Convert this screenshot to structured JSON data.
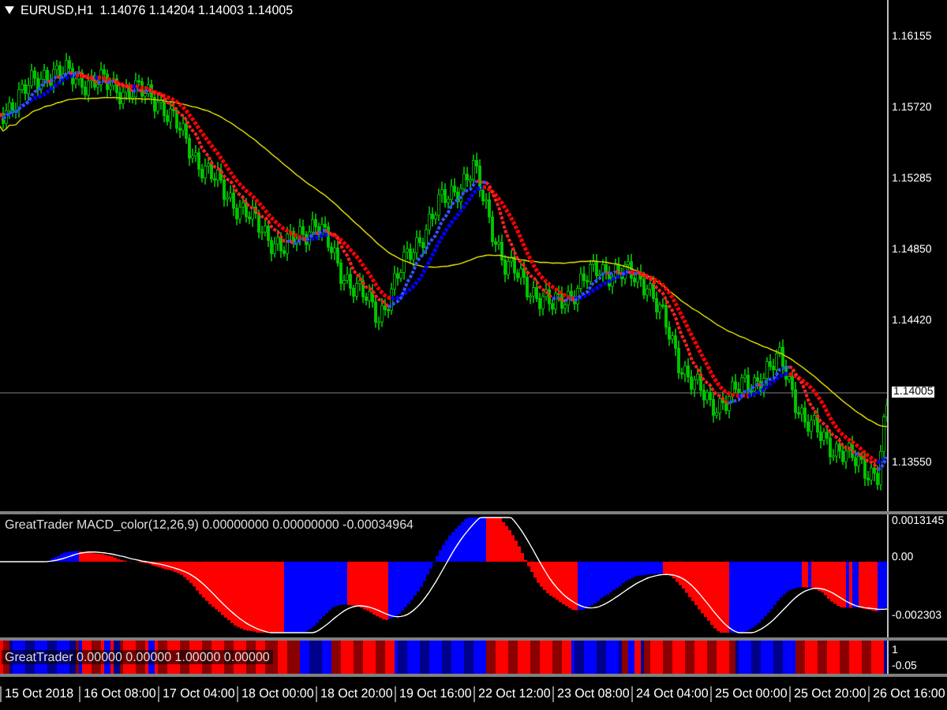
{
  "main_chart": {
    "symbol": "EURUSD,H1",
    "quotes": "1.14076 1.14204 1.14003 1.14005",
    "price_axis": [
      {
        "label": "1.16155",
        "kind": "tick"
      },
      {
        "label": "1.15720",
        "kind": "tick"
      },
      {
        "label": "1.15285",
        "kind": "tick"
      },
      {
        "label": "1.14850",
        "kind": "tick"
      },
      {
        "label": "1.14420",
        "kind": "tick"
      },
      {
        "label": "1.14005",
        "kind": "current"
      },
      {
        "label": "1.13550",
        "kind": "tick"
      }
    ]
  },
  "macd_panel": {
    "header": "GreatTrader MACD_color(12,26,9) 0.00000000 0.00000000 -0.00034964",
    "axis": [
      "0.0013145",
      "0.00",
      "-0.002303"
    ]
  },
  "signal_panel": {
    "header": "GreatTrader 0.00000 0.00000 1.00000 0.00000",
    "axis": [
      "1",
      "-0.05"
    ]
  },
  "time_axis": [
    "15 Oct 2018",
    "16 Oct 08:00",
    "17 Oct 04:00",
    "18 Oct 00:00",
    "18 Oct 20:00",
    "19 Oct 16:00",
    "22 Oct 12:00",
    "23 Oct 08:00",
    "24 Oct 04:00",
    "25 Oct 00:00",
    "25 Oct 20:00",
    "26 Oct 16:00"
  ]
}
